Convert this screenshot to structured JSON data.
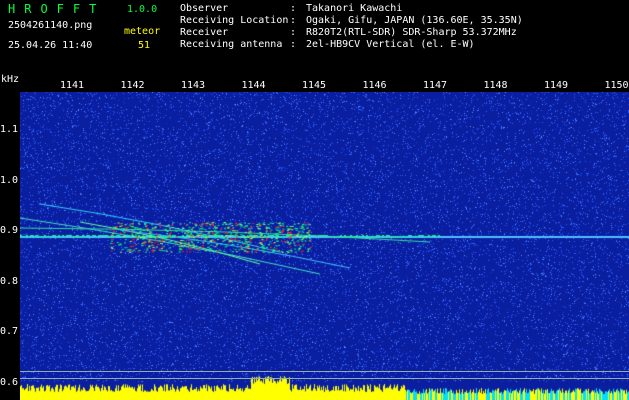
{
  "header": {
    "app_title": "HROFFT",
    "app_version": "1.0.0",
    "filename": "2504261140.png",
    "mode": "meteor",
    "datetime": "25.04.26 11:40",
    "count": "51"
  },
  "info": [
    {
      "label": "Observer",
      "value": "Takanori Kawachi"
    },
    {
      "label": "Receiving Location",
      "value": "Ogaki, Gifu, JAPAN (136.60E, 35.35N)"
    },
    {
      "label": "Receiver",
      "value": "R820T2(RTL-SDR) SDR-Sharp 53.372MHz"
    },
    {
      "label": "Receiving antenna",
      "value": "2el-HB9CV Vertical (el. E-W)"
    }
  ],
  "spectrogram": {
    "y_unit": "kHz",
    "time_ticks": [
      "1141",
      "1142",
      "1143",
      "1144",
      "1145",
      "1146",
      "1147",
      "1148",
      "1149",
      "1150"
    ],
    "freq_ticks": [
      "1.1",
      "1.0",
      "0.9",
      "0.8",
      "0.7",
      "0.6"
    ],
    "colors": {
      "background": "#0a1ea0",
      "noise": "#2a60ff",
      "signal": "#00ff80",
      "strong": "#ff2020",
      "level": "#ffff00",
      "level_alt": "#00e0ff"
    }
  }
}
